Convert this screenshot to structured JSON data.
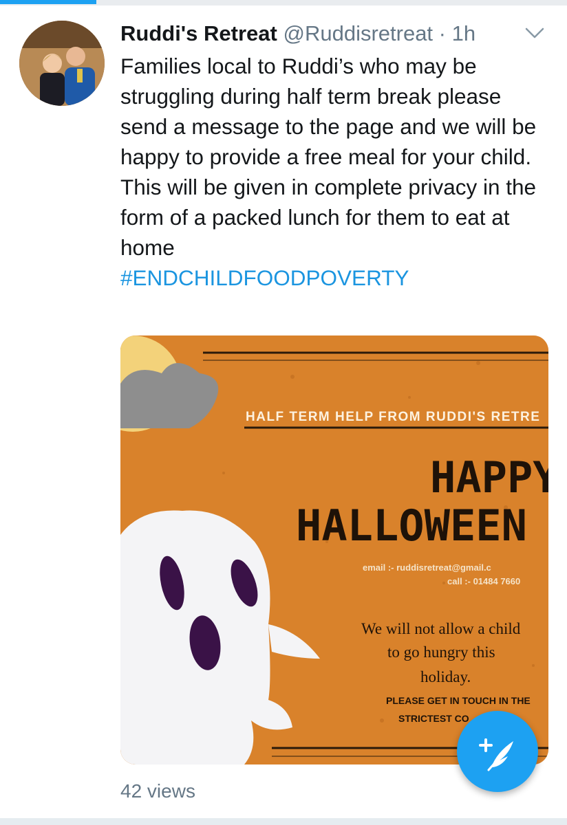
{
  "tweet": {
    "author_name": "Ruddi's Retreat",
    "handle": "@Ruddisretreat",
    "separator": "·",
    "time": "1h",
    "text_para1": "Families local to Ruddi’s who may be struggling during half term break please send a message to the page and we will be happy to provide a free meal for your child.",
    "text_para2": "This will be given in complete privacy in the form of a packed lunch for them to eat at home",
    "hashtag": "#ENDCHILDFOODPOVERTY",
    "views": "42 views",
    "more_icon": "chevron-down-icon"
  },
  "media": {
    "heading": "HALF TERM HELP FROM RUDDI'S RETRE",
    "happy": "HAPPY",
    "halloween": "HALLOWEEN",
    "email_line": "email :- ruddisretreat@gmail.c",
    "call_line": "call :- 01484 7660",
    "message_line1": "We will not allow a child",
    "message_line2": "to go hungry this",
    "message_line3": "holiday.",
    "footer_line1": "PLEASE GET IN TOUCH IN THE",
    "footer_line2": "STRICTEST CO",
    "background_color": "#d9822b"
  },
  "compose_button": {
    "icon": "compose-feather-icon",
    "color": "#1da1f2"
  }
}
